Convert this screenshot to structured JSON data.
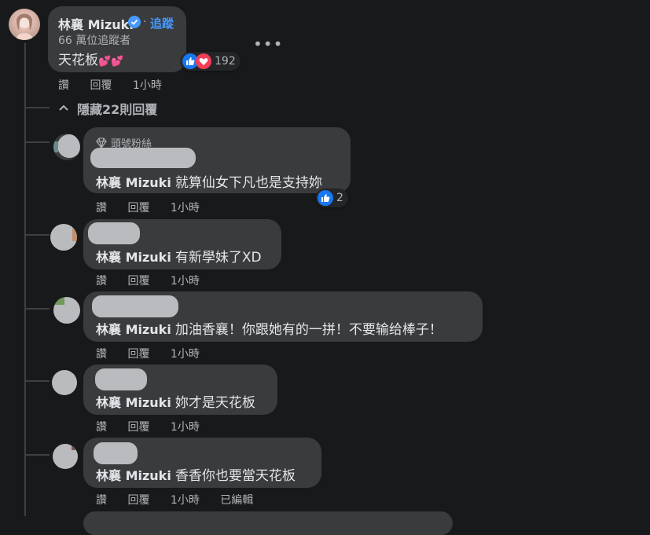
{
  "top_comment": {
    "author": "林襄 Mizuki",
    "follow_label": "追蹤",
    "followers": "66 萬位追蹤者",
    "text": "天花板",
    "emoji": "💕💕",
    "reaction_count": "192",
    "actions": {
      "like": "讚",
      "reply": "回覆",
      "time": "1小時"
    }
  },
  "hidden_replies_label": "隱藏22則回覆",
  "replies": [
    {
      "badge": "頭號粉絲",
      "mention": "林襄 Mizuki",
      "text": "就算仙女下凡也是支持妳",
      "reaction_count": "2",
      "like": "讚",
      "reply": "回覆",
      "time": "1小時"
    },
    {
      "mention": "林襄 Mizuki",
      "text": "有新學妹了XD",
      "like": "讚",
      "reply": "回覆",
      "time": "1小時"
    },
    {
      "mention": "林襄 Mizuki",
      "text": "加油香襄！你跟她有的一拼！不要输给棒子！",
      "like": "讚",
      "reply": "回覆",
      "time": "1小時"
    },
    {
      "mention": "林襄 Mizuki",
      "text": "妳才是天花板",
      "like": "讚",
      "reply": "回覆",
      "time": "1小時"
    },
    {
      "mention": "林襄 Mizuki",
      "text": "香香你也要當天花板",
      "like": "讚",
      "reply": "回覆",
      "time": "1小時",
      "edited": "已編輯"
    }
  ],
  "colors": {
    "background": "#18191a",
    "bubble": "#3a3b3c",
    "link": "#4599ff",
    "like_blue": "#1877f2",
    "love_red": "#f33e58"
  }
}
